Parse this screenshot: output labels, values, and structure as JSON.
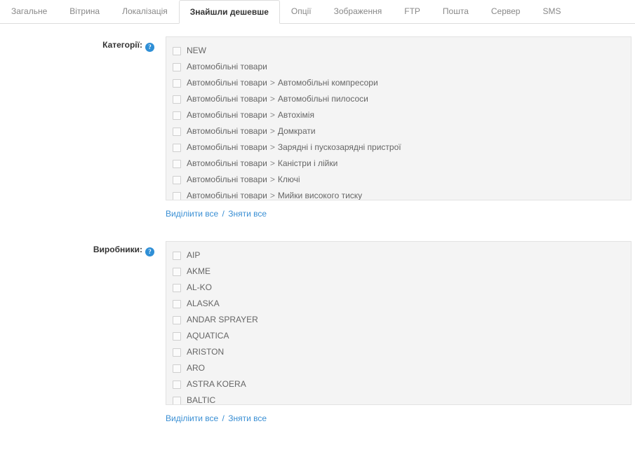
{
  "tabs": [
    {
      "label": "Загальне",
      "active": false
    },
    {
      "label": "Вітрина",
      "active": false
    },
    {
      "label": "Локалізація",
      "active": false
    },
    {
      "label": "Знайшли дешевше",
      "active": true
    },
    {
      "label": "Опції",
      "active": false
    },
    {
      "label": "Зображення",
      "active": false
    },
    {
      "label": "FTP",
      "active": false
    },
    {
      "label": "Пошта",
      "active": false
    },
    {
      "label": "Сервер",
      "active": false
    },
    {
      "label": "SMS",
      "active": false
    }
  ],
  "help_icon_glyph": "?",
  "accent_color": "#3a8fd4",
  "sections": [
    {
      "key": "categories",
      "label": "Категорії:",
      "help_icon": "help-circle-icon",
      "items": [
        {
          "parent": "",
          "name": "NEW",
          "checked": false
        },
        {
          "parent": "",
          "name": "Автомобільні товари",
          "checked": false
        },
        {
          "parent": "Автомобільні товари",
          "name": "Автомобільні компресори",
          "checked": false
        },
        {
          "parent": "Автомобільні товари",
          "name": "Автомобільні пилососи",
          "checked": false
        },
        {
          "parent": "Автомобільні товари",
          "name": "Автохімія",
          "checked": false
        },
        {
          "parent": "Автомобільні товари",
          "name": "Домкрати",
          "checked": false
        },
        {
          "parent": "Автомобільні товари",
          "name": "Зарядні і пускозарядні пристрої",
          "checked": false
        },
        {
          "parent": "Автомобільні товари",
          "name": "Каністри і лійки",
          "checked": false
        },
        {
          "parent": "Автомобільні товари",
          "name": "Ключі",
          "checked": false
        },
        {
          "parent": "Автомобільні товари",
          "name": "Мийки високого тиску",
          "checked": false
        }
      ],
      "select_all": "Виділіити все",
      "divider": "/",
      "unselect_all": "Зняти все"
    },
    {
      "key": "manufacturers",
      "label": "Виробники:",
      "help_icon": "help-circle-icon",
      "items": [
        {
          "parent": "",
          "name": "AIP",
          "checked": false
        },
        {
          "parent": "",
          "name": "AKME",
          "checked": false
        },
        {
          "parent": "",
          "name": "AL-KO",
          "checked": false
        },
        {
          "parent": "",
          "name": "ALASKA",
          "checked": false
        },
        {
          "parent": "",
          "name": "ANDAR SPRAYER",
          "checked": false
        },
        {
          "parent": "",
          "name": "AQUATICA",
          "checked": false
        },
        {
          "parent": "",
          "name": "ARISTON",
          "checked": false
        },
        {
          "parent": "",
          "name": "ARO",
          "checked": false
        },
        {
          "parent": "",
          "name": "ASTRA KOERA",
          "checked": false
        },
        {
          "parent": "",
          "name": "BALTIC",
          "checked": false
        }
      ],
      "select_all": "Виділіити все",
      "divider": "/",
      "unselect_all": "Зняти все"
    }
  ]
}
